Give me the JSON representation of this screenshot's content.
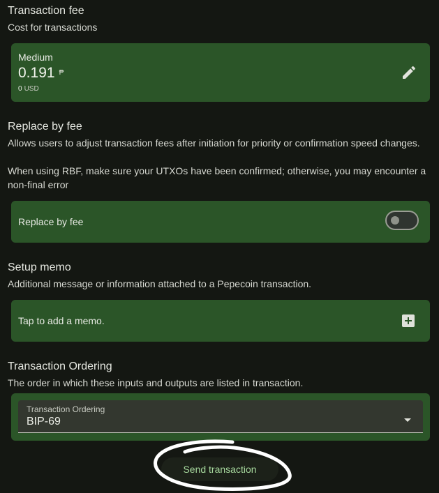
{
  "fee": {
    "title": "Transaction fee",
    "description": "Cost for transactions",
    "level": "Medium",
    "amount": "0.191",
    "unit_symbol": "₱",
    "fiat_amount": "0",
    "fiat_currency": "USD",
    "edit_icon": "pencil-icon"
  },
  "rbf": {
    "title": "Replace by fee",
    "description_line1": "Allows users to adjust transaction fees after initiation for priority or confirmation speed changes.",
    "description_line2": "When using RBF, make sure your UTXOs have been confirmed; otherwise, you may encounter a non-final error",
    "toggle_label": "Replace by fee",
    "enabled": false
  },
  "memo": {
    "title": "Setup memo",
    "description": "Additional message or information attached to a Pepecoin transaction.",
    "placeholder": "Tap to add a memo.",
    "add_icon": "add-box-icon"
  },
  "ordering": {
    "title": "Transaction Ordering",
    "description": "The order in which these inputs and outputs are listed in transaction.",
    "field_label": "Transaction Ordering",
    "selected": "BIP-69"
  },
  "send": {
    "label": "Send transaction"
  },
  "colors": {
    "background": "#141712",
    "card": "#2b5528",
    "send_text": "#a7d99e",
    "annotation": "#ffffff"
  }
}
